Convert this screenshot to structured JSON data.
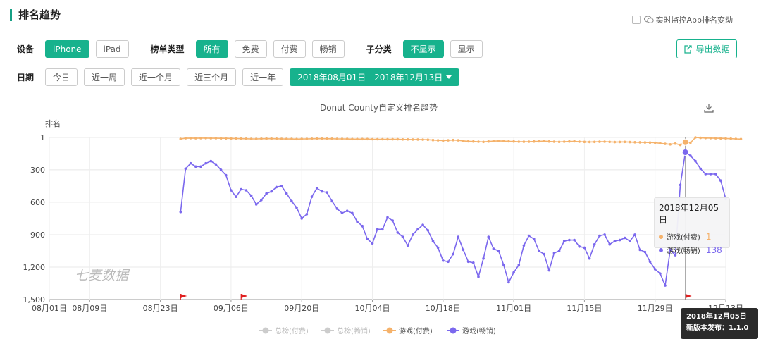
{
  "header": {
    "title": "排名趋势"
  },
  "monitor": {
    "label": "实时监控App排名变动",
    "checked": false
  },
  "filters": {
    "device_label": "设备",
    "devices": [
      {
        "label": "iPhone",
        "active": true
      },
      {
        "label": "iPad",
        "active": false
      }
    ],
    "list_type_label": "榜单类型",
    "list_types": [
      {
        "label": "所有",
        "active": true
      },
      {
        "label": "免费",
        "active": false
      },
      {
        "label": "付费",
        "active": false
      },
      {
        "label": "畅销",
        "active": false
      }
    ],
    "subcat_label": "子分类",
    "subcats": [
      {
        "label": "不显示",
        "active": true
      },
      {
        "label": "显示",
        "active": false
      }
    ],
    "date_label": "日期",
    "dates": [
      {
        "label": "今日"
      },
      {
        "label": "近一周"
      },
      {
        "label": "近一个月"
      },
      {
        "label": "近三个月"
      },
      {
        "label": "近一年"
      }
    ],
    "date_range": "2018年08月01日 - 2018年12月13日"
  },
  "export": {
    "label": "导出数据"
  },
  "chart_data": {
    "type": "line",
    "title": "Donut County自定义排名趋势",
    "ylabel": "排名",
    "y_inverted": true,
    "ylim": [
      1,
      1500
    ],
    "y_ticks": [
      "1",
      "300",
      "600",
      "900",
      "1,200",
      "1,500"
    ],
    "x_ticks": [
      {
        "label": "08月01日",
        "day": 0
      },
      {
        "label": "08月09日",
        "day": 8
      },
      {
        "label": "08月23日",
        "day": 22
      },
      {
        "label": "09月06日",
        "day": 36
      },
      {
        "label": "09月20日",
        "day": 50
      },
      {
        "label": "10月04日",
        "day": 64
      },
      {
        "label": "10月18日",
        "day": 78
      },
      {
        "label": "11月01日",
        "day": 92
      },
      {
        "label": "11月15日",
        "day": 106
      },
      {
        "label": "11月29日",
        "day": 120
      },
      {
        "label": "12月13日",
        "day": 134
      }
    ],
    "x_start_date": "2018-08-01",
    "x_range_days": [
      0,
      134
    ],
    "grid": true,
    "legend_position": "bottom",
    "legend": [
      {
        "name": "总榜(付费)",
        "color": "#cccccc",
        "enabled": false
      },
      {
        "name": "总榜(畅销)",
        "color": "#cccccc",
        "enabled": false
      },
      {
        "name": "游戏(付费)",
        "color": "#f5b26b",
        "enabled": true
      },
      {
        "name": "游戏(畅销)",
        "color": "#7b68ee",
        "enabled": true
      }
    ],
    "series": [
      {
        "name": "游戏(付费)",
        "color": "#f5b26b",
        "start_day": 26,
        "values": [
          14,
          8,
          7,
          8,
          7,
          7,
          8,
          8,
          9,
          9,
          10,
          11,
          12,
          13,
          14,
          14,
          13,
          12,
          12,
          13,
          14,
          15,
          15,
          16,
          15,
          14,
          13,
          12,
          12,
          13,
          13,
          14,
          14,
          15,
          16,
          16,
          16,
          16,
          17,
          17,
          17,
          18,
          18,
          18,
          19,
          19,
          20,
          20,
          21,
          22,
          25,
          28,
          30,
          28,
          25,
          28,
          33,
          36,
          38,
          40,
          42,
          38,
          35,
          33,
          35,
          37,
          38,
          40,
          41,
          40,
          38,
          37,
          35,
          38,
          40,
          42,
          40,
          38,
          37,
          40,
          42,
          43,
          42,
          41,
          40,
          42,
          44,
          43,
          42,
          44,
          45,
          46,
          47,
          48,
          50,
          55,
          60,
          65,
          58,
          70,
          45,
          50,
          1,
          5,
          6,
          7,
          8,
          9,
          10,
          12,
          14,
          16
        ]
      },
      {
        "name": "游戏(畅销)",
        "color": "#7b68ee",
        "start_day": 26,
        "values": [
          690,
          290,
          240,
          270,
          270,
          240,
          220,
          250,
          300,
          350,
          490,
          550,
          480,
          490,
          540,
          620,
          580,
          520,
          500,
          460,
          450,
          520,
          590,
          650,
          750,
          710,
          550,
          470,
          500,
          510,
          590,
          660,
          700,
          680,
          700,
          780,
          820,
          940,
          980,
          850,
          850,
          740,
          770,
          880,
          920,
          1000,
          900,
          850,
          810,
          860,
          960,
          1020,
          1140,
          1150,
          1080,
          920,
          1040,
          1150,
          1160,
          1290,
          1120,
          920,
          1030,
          1050,
          1180,
          1340,
          1250,
          1180,
          1000,
          910,
          940,
          1050,
          1080,
          1230,
          1070,
          1050,
          960,
          950,
          950,
          1010,
          1020,
          1120,
          990,
          910,
          900,
          990,
          960,
          950,
          930,
          960,
          900,
          1040,
          1060,
          1150,
          1220,
          1260,
          1370,
          1040,
          1090,
          440,
          138,
          170,
          220,
          290,
          340,
          340,
          340,
          400,
          570
        ]
      }
    ],
    "release_markers": [
      {
        "day": 26
      },
      {
        "day": 38
      },
      {
        "day": 126
      }
    ],
    "tooltip": {
      "date": "2018年12月05日",
      "rows": [
        {
          "name": "游戏(付费)",
          "value": "1",
          "color": "#f5b26b"
        },
        {
          "name": "游戏(畅销)",
          "value": "138",
          "color": "#7b68ee"
        }
      ]
    },
    "release_tip": {
      "date": "2018年12月05日",
      "text": "新版本发布：1.1.0"
    },
    "watermark": "七麦数据"
  }
}
